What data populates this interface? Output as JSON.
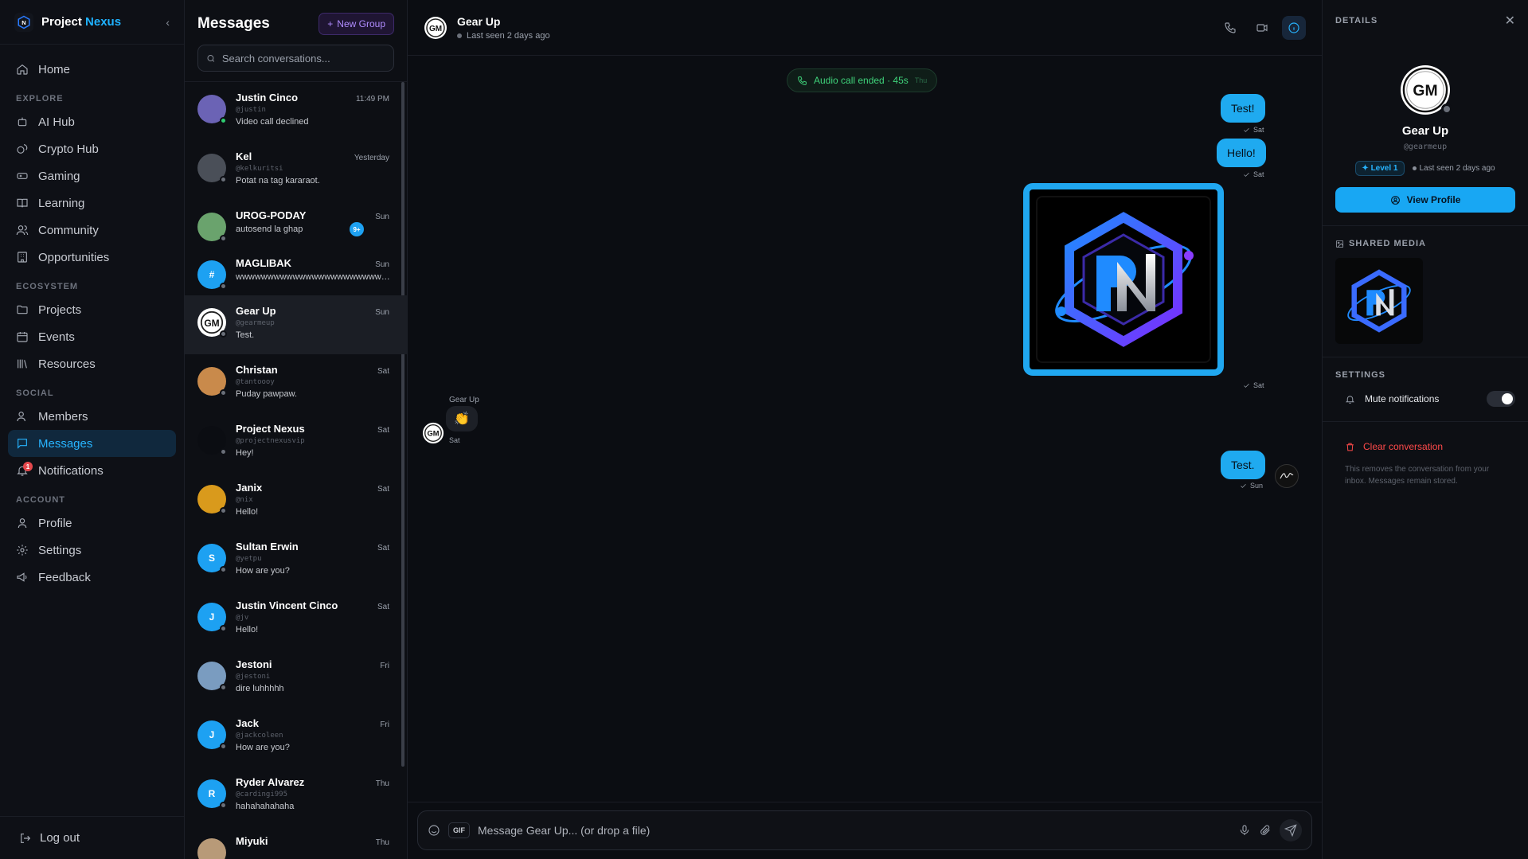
{
  "brand": {
    "name_a": "Project ",
    "name_b": "Nexus"
  },
  "nav": {
    "home": "Home",
    "explore_label": "EXPLORE",
    "explore": [
      "AI Hub",
      "Crypto Hub",
      "Gaming",
      "Learning",
      "Community",
      "Opportunities"
    ],
    "ecosystem_label": "ECOSYSTEM",
    "ecosystem": [
      "Projects",
      "Events",
      "Resources"
    ],
    "social_label": "SOCIAL",
    "social": [
      "Members",
      "Messages",
      "Notifications"
    ],
    "notifications_badge": "1",
    "account_label": "ACCOUNT",
    "account": [
      "Profile",
      "Settings",
      "Feedback"
    ],
    "logout": "Log out"
  },
  "convos": {
    "title": "Messages",
    "new_group": "New Group",
    "search_placeholder": "Search conversations...",
    "items": [
      {
        "name": "Justin Cinco",
        "handle": "@justin",
        "time": "11:49 PM",
        "preview": "Video call declined",
        "color": "#6b63b5",
        "online": true
      },
      {
        "name": "Kel",
        "handle": "@kelkuritsi",
        "time": "Yesterday",
        "preview": "Potat na tag kararaot.",
        "color": "#4a4f58",
        "online": false
      },
      {
        "name": "UROG-PODAY",
        "handle": "",
        "time": "Sun",
        "preview": "autosend la ghap",
        "color": "#6aa36d",
        "online": false,
        "badge": "9+"
      },
      {
        "name": "MAGLIBAK",
        "handle": "",
        "time": "Sun",
        "preview": "wwwwwwwwwwwwwwwwwwwwwwwwwww",
        "color": "#1da1f2",
        "online": false,
        "initial": "#"
      },
      {
        "name": "Gear Up",
        "handle": "@gearmeup",
        "time": "Sun",
        "preview": "Test.",
        "color": "#ffffff",
        "online": false,
        "active": true
      },
      {
        "name": "Christan",
        "handle": "@tantoooy",
        "time": "Sat",
        "preview": "Puday pawpaw.",
        "color": "#c98a4b",
        "online": false
      },
      {
        "name": "Project Nexus",
        "handle": "@projectnexusvip",
        "time": "Sat",
        "preview": "Hey!",
        "color": "#0b0d12",
        "online": false
      },
      {
        "name": "Janix",
        "handle": "@nix",
        "time": "Sat",
        "preview": "Hello!",
        "color": "#d99a1c",
        "online": false
      },
      {
        "name": "Sultan Erwin",
        "handle": "@yetpu",
        "time": "Sat",
        "preview": "How are you?",
        "color": "#1da1f2",
        "online": false,
        "initial": "S"
      },
      {
        "name": "Justin Vincent Cinco",
        "handle": "@jv",
        "time": "Sat",
        "preview": "Hello!",
        "color": "#1da1f2",
        "online": false,
        "initial": "J"
      },
      {
        "name": "Jestoni",
        "handle": "@jestoni",
        "time": "Fri",
        "preview": "dire luhhhhh",
        "color": "#7a9cc0",
        "online": false
      },
      {
        "name": "Jack",
        "handle": "@jackcoleen",
        "time": "Fri",
        "preview": "How are you?",
        "color": "#1da1f2",
        "online": false,
        "initial": "J"
      },
      {
        "name": "Ryder Alvarez",
        "handle": "@cardingi995",
        "time": "Thu",
        "preview": "hahahahahaha",
        "color": "#1da1f2",
        "online": false,
        "initial": "R"
      },
      {
        "name": "Miyuki",
        "handle": "",
        "time": "Thu",
        "preview": "",
        "color": "#b89a78",
        "online": false
      }
    ]
  },
  "chat": {
    "name": "Gear Up",
    "status": "Last seen 2 days ago",
    "system": {
      "text": "Audio call ended · 45s",
      "time": "Thu"
    },
    "out_1": {
      "text": "Test!",
      "time": "Sat"
    },
    "out_2": {
      "text": "Hello!",
      "time": "Sat"
    },
    "out_img_time": "Sat",
    "in_1": {
      "sender": "Gear Up",
      "emoji": "👏",
      "time": "Sat"
    },
    "out_3": {
      "text": "Test.",
      "time": "Sun"
    },
    "composer_placeholder": "Message Gear Up... (or drop a file)",
    "gif_label": "GIF"
  },
  "details": {
    "title": "DETAILS",
    "name": "Gear Up",
    "handle": "@gearmeup",
    "level": "Level 1",
    "last_seen": "Last seen 2 days ago",
    "view_profile": "View Profile",
    "shared_media_label": "SHARED MEDIA",
    "settings_label": "SETTINGS",
    "mute_label": "Mute notifications",
    "clear_label": "Clear conversation",
    "clear_note": "This removes the conversation from your inbox. Messages remain stored."
  },
  "colors": {
    "accent": "#1faaf0",
    "danger": "#ff4a4a",
    "online": "#2ecc71",
    "purple": "#b08cff"
  }
}
